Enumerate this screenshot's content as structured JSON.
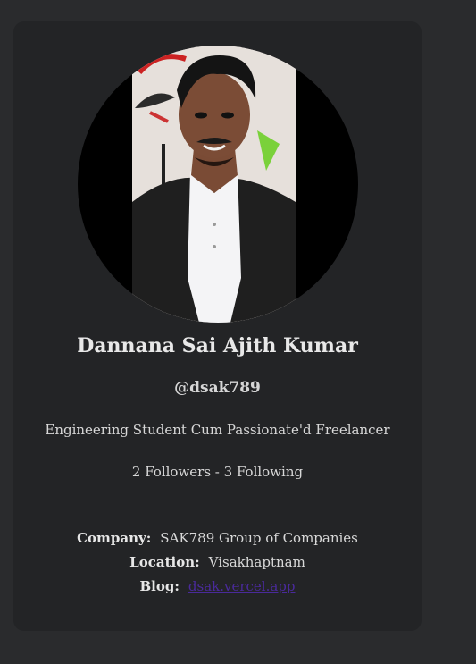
{
  "profile": {
    "name": "Dannana Sai Ajith Kumar",
    "handle": "@dsak789",
    "bio": "Engineering Student Cum Passionate'd Freelancer",
    "followers_text": "2 Followers - 3 Following"
  },
  "info": {
    "company_label": "Company:",
    "company_value": "SAK789 Group of Companies",
    "location_label": "Location:",
    "location_value": "Visakhaptnam",
    "blog_label": "Blog:",
    "blog_value": "dsak.vercel.app"
  },
  "colors": {
    "page_bg": "#2a2b2d",
    "card_bg": "#232426",
    "text": "#d8d8d8",
    "link": "#4a2a9b"
  }
}
